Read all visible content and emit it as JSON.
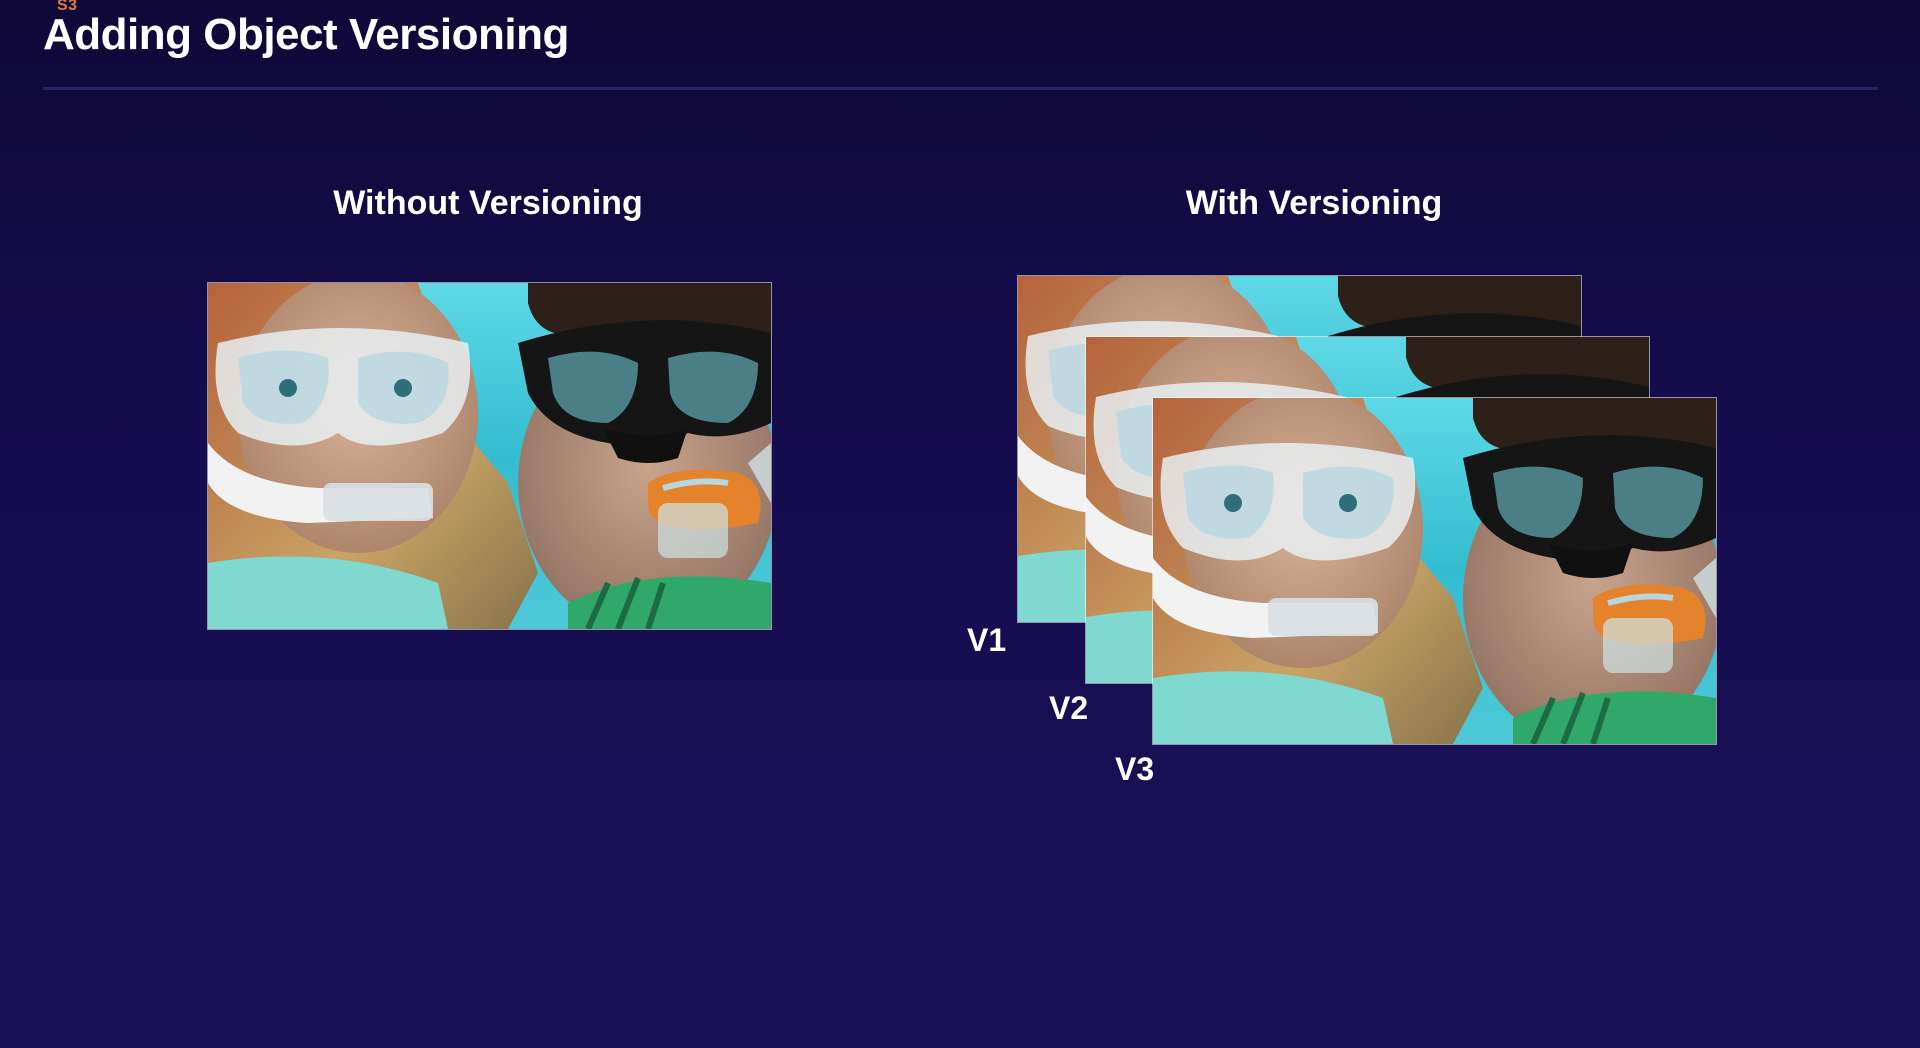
{
  "slide": {
    "eyebrow": "S3",
    "title": "Adding Object Versioning"
  },
  "left_column": {
    "heading": "Without Versioning",
    "image_icon": "snorkel-photo"
  },
  "right_column": {
    "heading": "With Versioning",
    "versions": [
      {
        "label": "V1"
      },
      {
        "label": "V2"
      },
      {
        "label": "V3"
      }
    ]
  },
  "colors": {
    "background_top": "#0f0838",
    "background_bottom": "#1a1158",
    "eyebrow_accent": "#e07b3a",
    "text": "#ffffff"
  }
}
